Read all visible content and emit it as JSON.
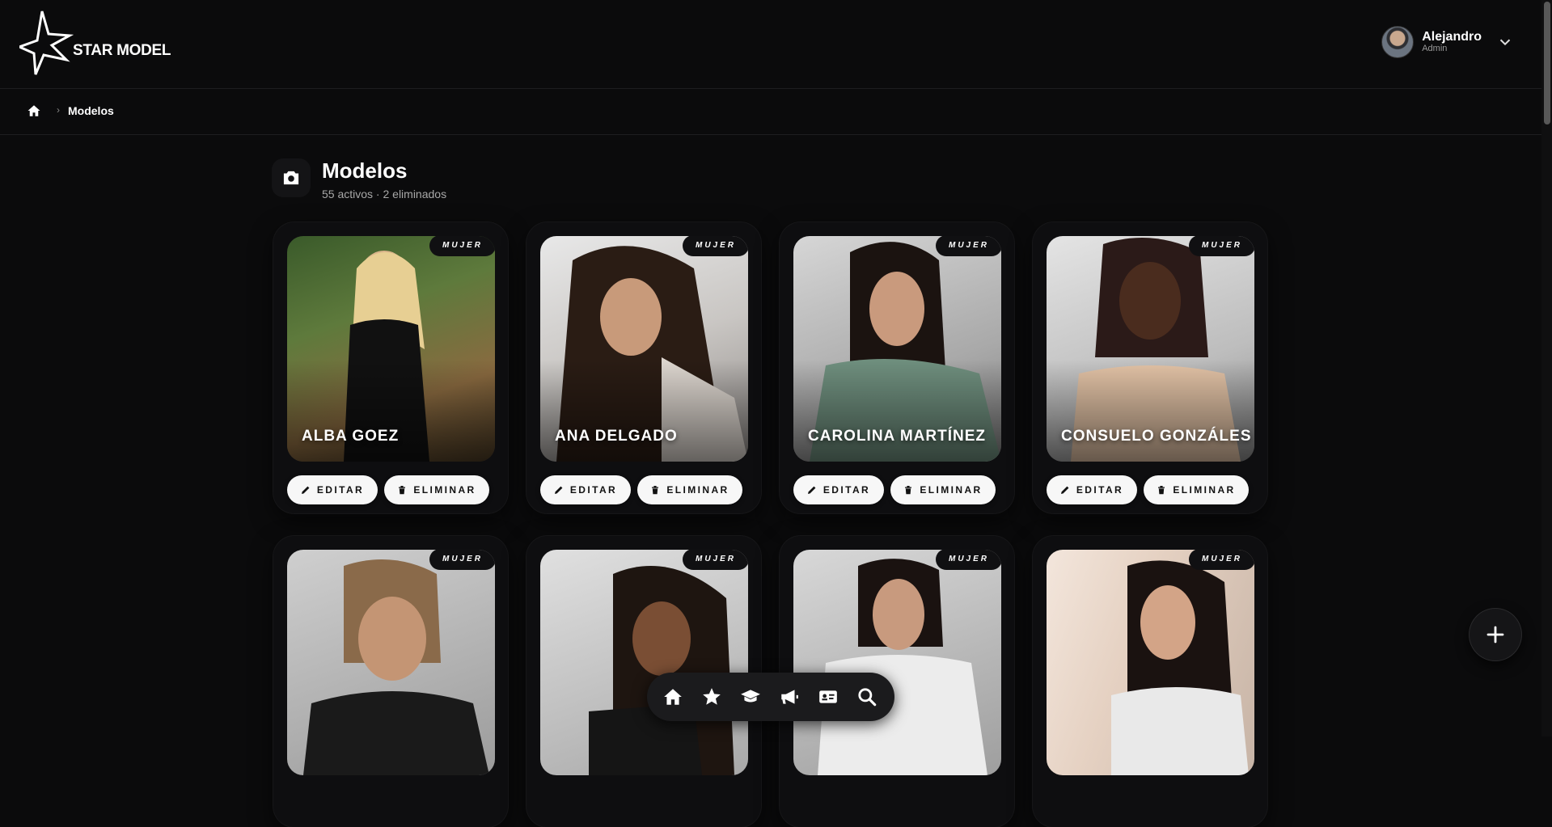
{
  "app": {
    "brand": "STAR MODEL"
  },
  "user": {
    "name": "Alejandro",
    "role": "Admin"
  },
  "breadcrumb": {
    "current": "Modelos"
  },
  "page": {
    "title": "Modelos",
    "subtitle": "55 activos · 2 eliminados"
  },
  "labels": {
    "edit": "EDITAR",
    "delete": "ELIMINAR"
  },
  "models": [
    {
      "name": "ALBA GOEZ",
      "tag": "MUJER"
    },
    {
      "name": "ANA DELGADO",
      "tag": "MUJER"
    },
    {
      "name": "CAROLINA MARTÍNEZ",
      "tag": "MUJER"
    },
    {
      "name": "CONSUELO GONZÁLES",
      "tag": "MUJER"
    },
    {
      "name": "",
      "tag": "MUJER"
    },
    {
      "name": "",
      "tag": "MUJER"
    },
    {
      "name": "",
      "tag": "MUJER"
    },
    {
      "name": "",
      "tag": "MUJER"
    }
  ],
  "dock": [
    "home-icon",
    "star-icon",
    "graduation-cap-icon",
    "megaphone-icon",
    "id-card-icon",
    "search-icon"
  ],
  "colors": {
    "background": "#0b0b0c",
    "card": "#0e0e10",
    "button": "#f7f7f7"
  }
}
